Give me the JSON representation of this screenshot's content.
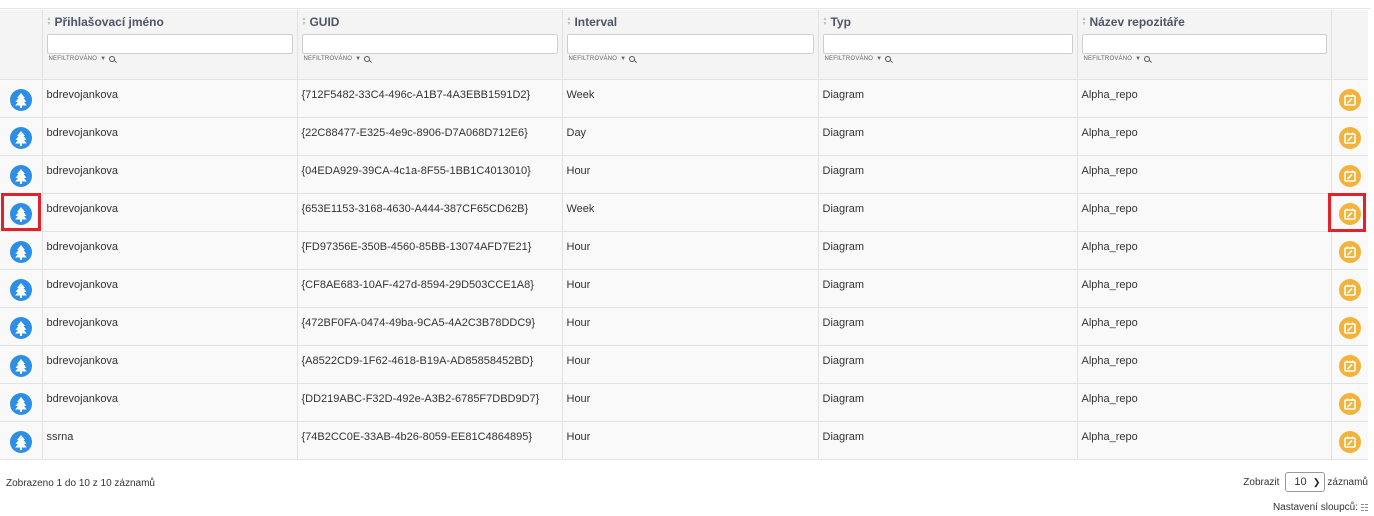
{
  "columns": [
    {
      "label": "Přihlašovací jméno",
      "filter_state": "NEFILTROVÁNO"
    },
    {
      "label": "GUID",
      "filter_state": "NEFILTROVÁNO"
    },
    {
      "label": "Interval",
      "filter_state": "NEFILTROVÁNO"
    },
    {
      "label": "Typ",
      "filter_state": "NEFILTROVÁNO"
    },
    {
      "label": "Název repozitáře",
      "filter_state": "NEFILTROVÁNO"
    }
  ],
  "rows": [
    {
      "login": "bdrevojankova",
      "guid": "{712F5482-33C4-496c-A1B7-4A3EBB1591D2}",
      "interval": "Week",
      "type": "Diagram",
      "repo": "Alpha_repo"
    },
    {
      "login": "bdrevojankova",
      "guid": "{22C88477-E325-4e9c-8906-D7A068D712E6}",
      "interval": "Day",
      "type": "Diagram",
      "repo": "Alpha_repo"
    },
    {
      "login": "bdrevojankova",
      "guid": "{04EDA929-39CA-4c1a-8F55-1BB1C4013010}",
      "interval": "Hour",
      "type": "Diagram",
      "repo": "Alpha_repo"
    },
    {
      "login": "bdrevojankova",
      "guid": "{653E1153-3168-4630-A444-387CF65CD62B}",
      "interval": "Week",
      "type": "Diagram",
      "repo": "Alpha_repo"
    },
    {
      "login": "bdrevojankova",
      "guid": "{FD97356E-350B-4560-85BB-13074AFD7E21}",
      "interval": "Hour",
      "type": "Diagram",
      "repo": "Alpha_repo"
    },
    {
      "login": "bdrevojankova",
      "guid": "{CF8AE683-10AF-427d-8594-29D503CCE1A8}",
      "interval": "Hour",
      "type": "Diagram",
      "repo": "Alpha_repo"
    },
    {
      "login": "bdrevojankova",
      "guid": "{472BF0FA-0474-49ba-9CA5-4A2C3B78DDC9}",
      "interval": "Hour",
      "type": "Diagram",
      "repo": "Alpha_repo"
    },
    {
      "login": "bdrevojankova",
      "guid": "{A8522CD9-1F62-4618-B19A-AD85858452BD}",
      "interval": "Hour",
      "type": "Diagram",
      "repo": "Alpha_repo"
    },
    {
      "login": "bdrevojankova",
      "guid": "{DD219ABC-F32D-492e-A3B2-6785F7DBD9D7}",
      "interval": "Hour",
      "type": "Diagram",
      "repo": "Alpha_repo"
    },
    {
      "login": "ssrna",
      "guid": "{74B2CC0E-33AB-4b26-8059-EE81C4864895}",
      "interval": "Hour",
      "type": "Diagram",
      "repo": "Alpha_repo"
    }
  ],
  "footer": {
    "info": "Zobrazeno 1 do 10 z 10 záznamů",
    "show_label": "Zobrazit",
    "page_size": "10",
    "records_label": "záznamů",
    "column_settings": "Nastavení sloupců:"
  },
  "icons": {
    "row_left": "tree-icon",
    "row_right": "calendar-edit-icon",
    "sort": "sort-icon",
    "filter_search": "search-icon",
    "column_settings": "columns-icon"
  },
  "colors": {
    "tree_icon": "#2d8ee5",
    "calendar_icon": "#f3b33a",
    "highlight": "#e0222a",
    "header_bg": "#f4f4f4"
  }
}
